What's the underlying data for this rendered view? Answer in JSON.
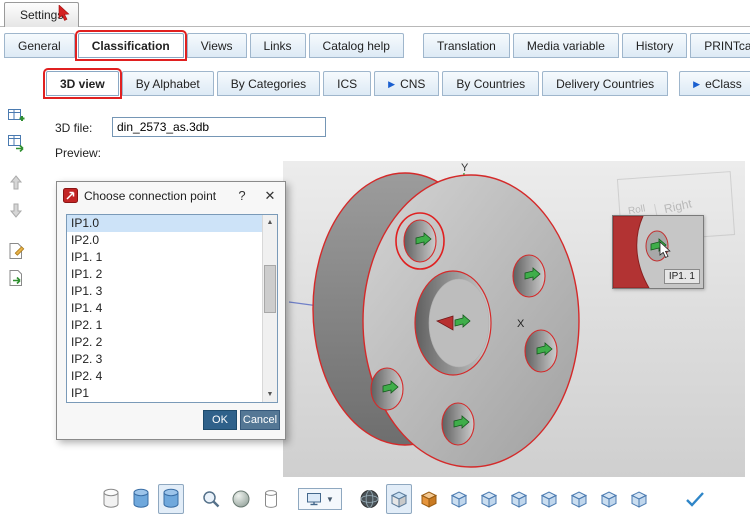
{
  "titlebar": {
    "settings_tab": "Settings"
  },
  "tabs1": [
    "General",
    "Classification",
    "Views",
    "Links",
    "Catalog help",
    "Translation",
    "Media variable",
    "History",
    "PRINTcatalog"
  ],
  "tabs1_active_index": 1,
  "tabs2": [
    "3D view",
    "By Alphabet",
    "By Categories",
    "ICS",
    "CNS",
    "By Countries",
    "Delivery Countries",
    "eClass"
  ],
  "tabs2_active_index": 0,
  "form": {
    "file_label": "3D file:",
    "file_value": "din_2573_as.3db",
    "preview_label": "Preview:"
  },
  "dialog": {
    "title": "Choose connection point",
    "help_glyph": "?",
    "close_glyph": "✕",
    "items": [
      "IP1.0",
      "IP2.0",
      "IP1. 1",
      "IP1. 2",
      "IP1. 3",
      "IP1. 4",
      "IP2. 1",
      "IP2. 2",
      "IP2. 3",
      "IP2. 4",
      "IP1"
    ],
    "selected_index": 0,
    "ok_label": "OK",
    "cancel_label": "Cancel"
  },
  "viewport": {
    "axis_x_label": "X",
    "axis_y_label": "Y",
    "tooltip_label": "IP1. 1",
    "viewcube": {
      "roll": "Roll",
      "right": "Right"
    }
  },
  "icons": {
    "play": "▶",
    "dropdown": "▼",
    "scroll_up": "▲",
    "scroll_down": "▼"
  },
  "colors": {
    "annotation_red": "#e02020",
    "edge_highlight_red": "#d42a2a",
    "connection_point_green": "#3fae4a",
    "selection_blue": "#cde3f8",
    "ok_button": "#2f618a"
  },
  "left_toolbar_icons": [
    "add-table",
    "import-table",
    "move-up",
    "move-down",
    "edit-document",
    "export-document"
  ],
  "bottom_toolbar_icons": [
    "cylinder-view",
    "shaded-cylinder-view",
    "shaded-cylinder-view-active",
    "zoom",
    "sphere-view",
    "cup-view",
    "display-mode-dropdown",
    "mesh-sphere-view",
    "solid-box-view",
    "textured-box-view",
    "wire-box",
    "wire-box",
    "wire-box",
    "wire-box",
    "wire-box",
    "wire-box",
    "wire-box",
    "confirm-check"
  ]
}
